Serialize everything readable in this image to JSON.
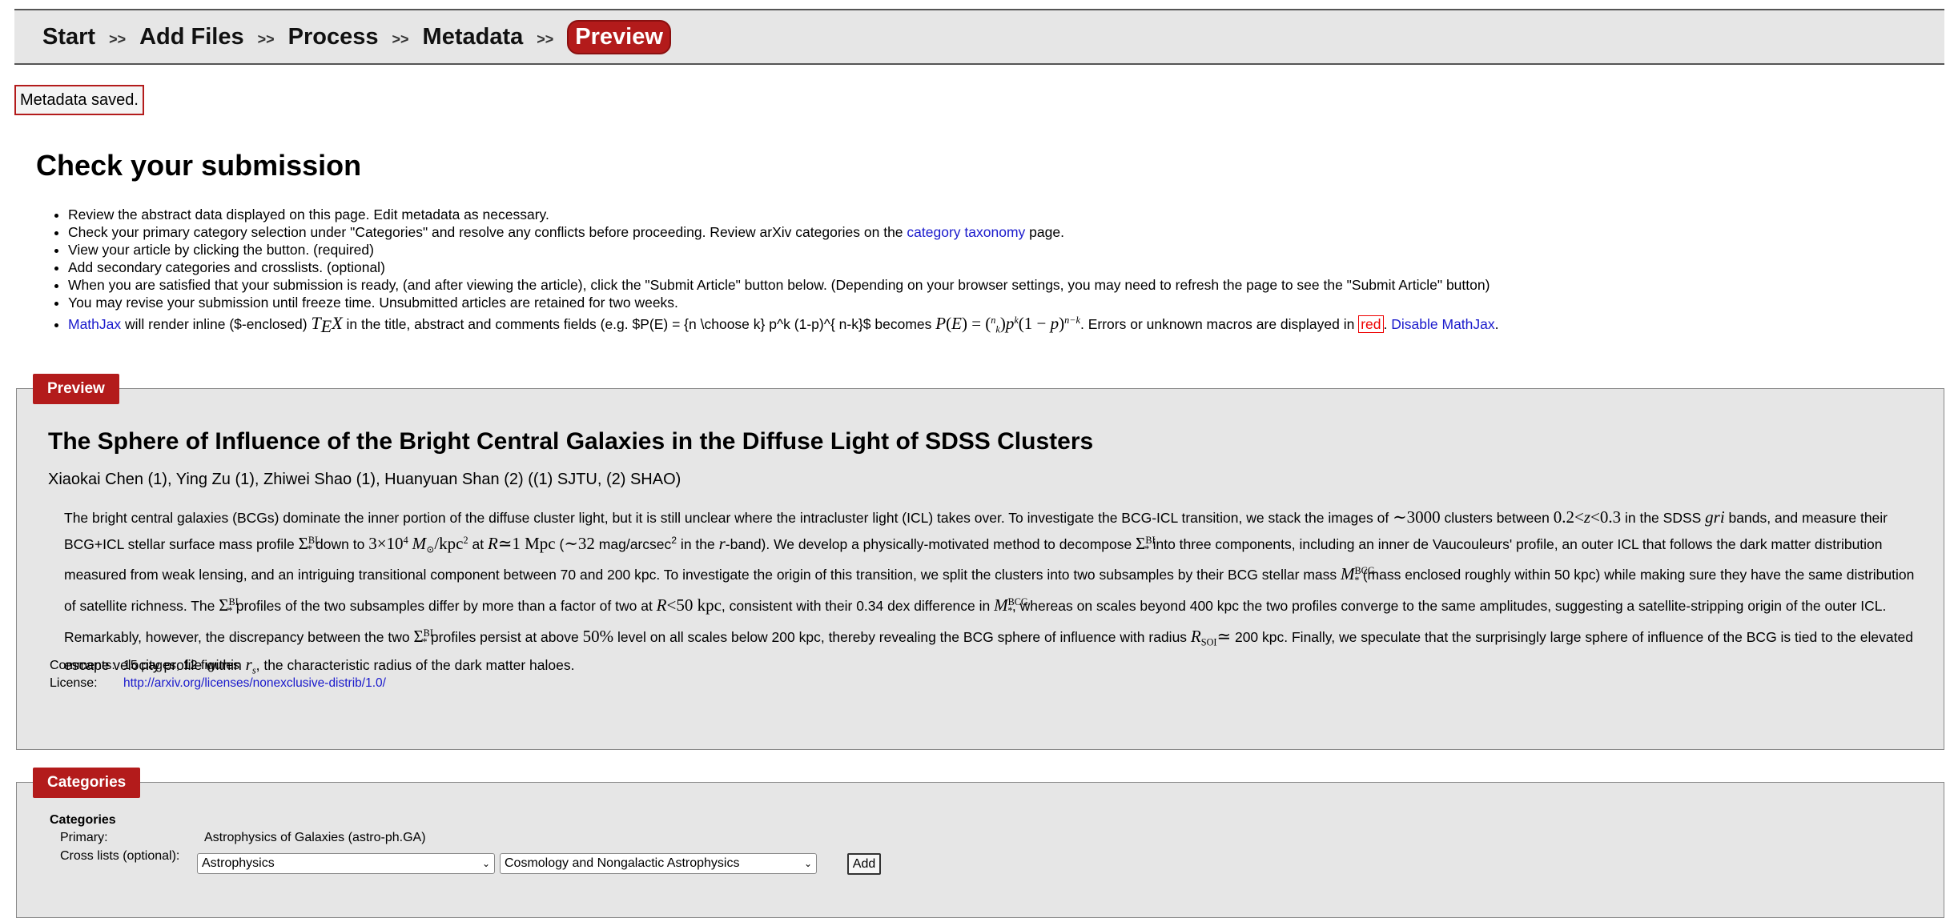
{
  "breadcrumb": {
    "steps": [
      "Start",
      "Add Files",
      "Process",
      "Metadata",
      "Preview"
    ],
    "separator": ">>"
  },
  "flash": "Metadata saved.",
  "page_title": "Check your submission",
  "instructions": {
    "item1": "Review the abstract data displayed on this page. Edit metadata as necessary.",
    "item2_pre": "Check your primary category selection under \"Categories\" and resolve any conflicts before proceeding. Review arXiv categories on the",
    "item2_link": "category taxonomy",
    "item2_post": "page.",
    "item3": "View your article by clicking the button. (required)",
    "item4": "Add secondary categories and crosslists. (optional)",
    "item5": "When you are satisfied that your submission is ready, (and after viewing the article), click the \"Submit Article\" button below. (Depending on your browser settings, you may need to refresh the page to see the \"Submit Article\" button)",
    "item6": "You may revise your submission until freeze time. Unsubmitted articles are retained for two weeks.",
    "item7_link": "MathJax",
    "item7_a": "will render inline ($-enclosed)",
    "item7_b": "in the title, abstract and comments fields (e.g. $P(E) = {n \\choose k} p^k (1-p)^{ n-k}$ becomes",
    "item7_c": ". Errors or unknown macros are displayed in",
    "item7_red": "red",
    "item7_disable": "Disable MathJax"
  },
  "preview": {
    "legend": "Preview",
    "title": "The Sphere of Influence of the Bright Central Galaxies in the Diffuse Light of SDSS Clusters",
    "authors": "Xiaokai Chen (1), Ying Zu (1), Zhiwei Shao (1), Huanyuan Shan (2) ((1) SJTU, (2) SHAO)",
    "comments_label": "Comments:",
    "comments": "15 pages, 12 figures",
    "license_label": "License:",
    "license": "http://arxiv.org/licenses/nonexclusive-distrib/1.0/"
  },
  "categories": {
    "legend": "Categories",
    "heading": "Categories",
    "primary_label": "Primary:",
    "primary": "Astrophysics of Galaxies (astro-ph.GA)",
    "cross_label": "Cross lists (optional):",
    "archive_select": "Astrophysics",
    "category_select": "Cosmology and Nongalactic Astrophysics",
    "add_label": "Add"
  },
  "colors": {
    "accent": "#b31b1b",
    "panel_bg": "#e6e6e6",
    "link": "#1a1acc"
  }
}
